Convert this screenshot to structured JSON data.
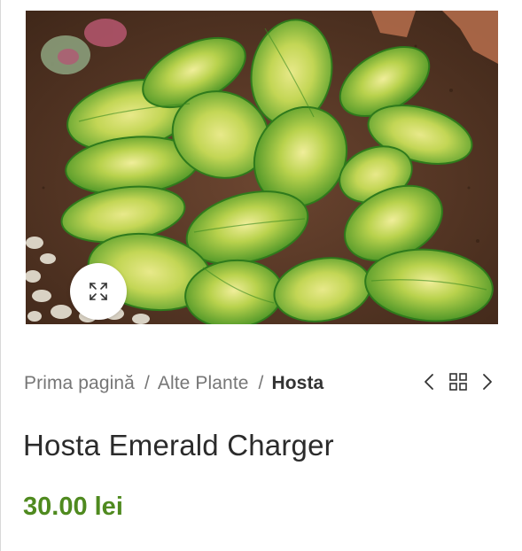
{
  "product_image": {
    "alt": "Hosta Emerald Charger"
  },
  "zoom": {
    "icon": "expand-arrows-icon"
  },
  "breadcrumb": {
    "items": [
      {
        "label": "Prima pagină"
      },
      {
        "label": "Alte Plante"
      },
      {
        "label": "Hosta"
      }
    ],
    "separator": "/"
  },
  "product_nav": {
    "prev_icon": "chevron-left-icon",
    "grid_icon": "grid-icon",
    "next_icon": "chevron-right-icon"
  },
  "product": {
    "title": "Hosta Emerald Charger",
    "price": "30.00 lei"
  },
  "colors": {
    "price": "#4f8a1f",
    "title": "#2b2b2b",
    "breadcrumb": "#767676",
    "breadcrumb_current": "#333333"
  }
}
